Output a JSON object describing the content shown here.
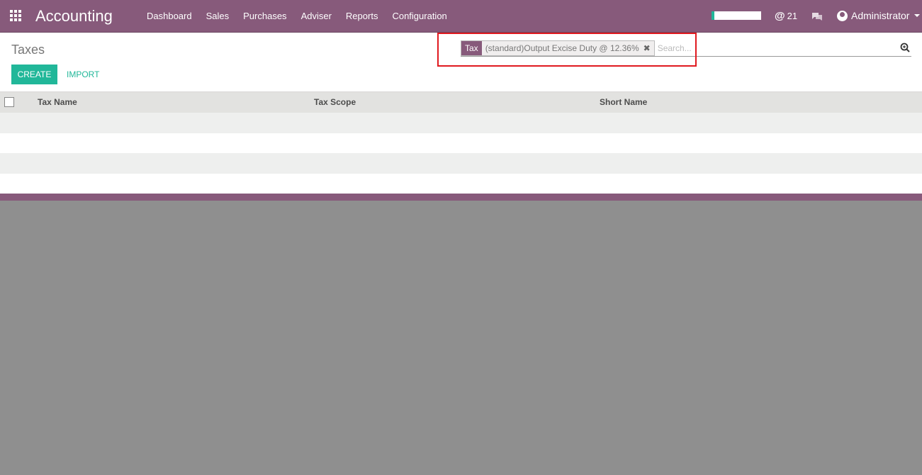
{
  "navbar": {
    "brand": "Accounting",
    "menu": [
      "Dashboard",
      "Sales",
      "Purchases",
      "Adviser",
      "Reports",
      "Configuration"
    ],
    "mentions_count": "21",
    "user_name": "Administrator"
  },
  "control_panel": {
    "title": "Taxes",
    "create_label": "CREATE",
    "import_label": "IMPORT",
    "search": {
      "facet_label": "Tax",
      "facet_value": "(standard)Output Excise Duty @ 12.36%",
      "placeholder": "Search..."
    }
  },
  "table": {
    "columns": [
      "Tax Name",
      "Tax Scope",
      "Short Name"
    ]
  },
  "colors": {
    "brand": "#875a7b",
    "accent": "#21b799",
    "highlight": "#e0191f"
  }
}
